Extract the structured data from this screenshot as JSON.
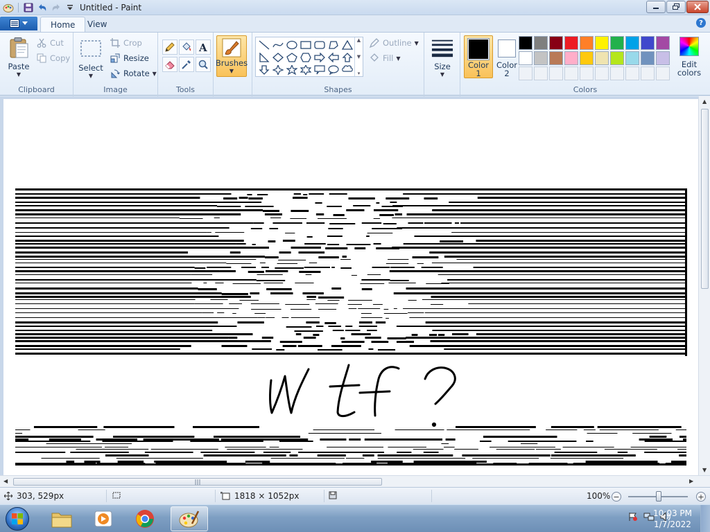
{
  "window": {
    "title": "Untitled - Paint"
  },
  "tabs": {
    "home": "Home",
    "view": "View"
  },
  "ribbon": {
    "clipboard": {
      "label": "Clipboard",
      "paste": "Paste",
      "cut": "Cut",
      "copy": "Copy"
    },
    "image": {
      "label": "Image",
      "select": "Select",
      "crop": "Crop",
      "resize": "Resize",
      "rotate": "Rotate"
    },
    "tools": {
      "label": "Tools"
    },
    "brushes": {
      "label": "Brushes"
    },
    "shapes": {
      "label": "Shapes",
      "outline": "Outline",
      "fill": "Fill"
    },
    "size": {
      "label": "Size"
    },
    "colors": {
      "label": "Colors",
      "color1_line1": "Color",
      "color1_line2": "1",
      "color2_line1": "Color",
      "color2_line2": "2",
      "edit_line1": "Edit",
      "edit_line2": "colors",
      "color1_value": "#000000",
      "color2_value": "#ffffff",
      "palette_row1": [
        "#000000",
        "#7f7f7f",
        "#880015",
        "#ed1c24",
        "#ff7f27",
        "#fff200",
        "#22b14c",
        "#00a2e8",
        "#3f48cc",
        "#a349a4"
      ],
      "palette_row2": [
        "#ffffff",
        "#c3c3c3",
        "#b97a57",
        "#ffaec9",
        "#ffc90e",
        "#efe4b0",
        "#b5e61d",
        "#99d9ea",
        "#7092be",
        "#c8bfe7"
      ]
    }
  },
  "canvas": {
    "handwritten_text": "Wtf?"
  },
  "status": {
    "cursor_position": "303, 529px",
    "image_size": "1818 × 1052px",
    "zoom": "100%"
  },
  "taskbar": {
    "time": "10:03 PM",
    "date": "1/7/2022"
  }
}
